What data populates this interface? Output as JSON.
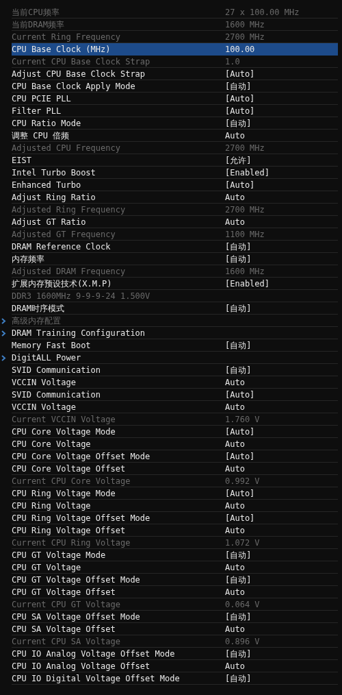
{
  "rows": [
    {
      "kind": "item",
      "label": "当前CPU频率",
      "value": "27 x 100.00 MHz",
      "disabled": true,
      "selected": false
    },
    {
      "kind": "item",
      "label": "当前DRAM频率",
      "value": "1600 MHz",
      "disabled": true,
      "selected": false
    },
    {
      "kind": "item",
      "label": "Current Ring Frequency",
      "value": "2700 MHz",
      "disabled": true,
      "selected": false
    },
    {
      "kind": "item",
      "label": "CPU Base Clock (MHz)",
      "value": "100.00",
      "disabled": false,
      "selected": true
    },
    {
      "kind": "item",
      "label": "Current CPU Base Clock Strap",
      "value": "1.0",
      "disabled": true,
      "selected": false
    },
    {
      "kind": "item",
      "label": "Adjust CPU Base Clock Strap",
      "value": "[Auto]",
      "disabled": false,
      "selected": false
    },
    {
      "kind": "item",
      "label": "CPU Base Clock Apply Mode",
      "value": "[自动]",
      "disabled": false,
      "selected": false
    },
    {
      "kind": "item",
      "label": "CPU PCIE PLL",
      "value": "[Auto]",
      "disabled": false,
      "selected": false
    },
    {
      "kind": "item",
      "label": "Filter PLL",
      "value": "[Auto]",
      "disabled": false,
      "selected": false
    },
    {
      "kind": "item",
      "label": "CPU Ratio Mode",
      "value": "[自动]",
      "disabled": false,
      "selected": false
    },
    {
      "kind": "item",
      "label": "调整 CPU 倍频",
      "value": "Auto",
      "disabled": false,
      "selected": false
    },
    {
      "kind": "item",
      "label": "Adjusted CPU Frequency",
      "value": "2700 MHz",
      "disabled": true,
      "selected": false
    },
    {
      "kind": "item",
      "label": "EIST",
      "value": "[允许]",
      "disabled": false,
      "selected": false
    },
    {
      "kind": "item",
      "label": "Intel Turbo Boost",
      "value": "[Enabled]",
      "disabled": false,
      "selected": false
    },
    {
      "kind": "item",
      "label": "Enhanced Turbo",
      "value": "[Auto]",
      "disabled": false,
      "selected": false
    },
    {
      "kind": "item",
      "label": "Adjust Ring Ratio",
      "value": "Auto",
      "disabled": false,
      "selected": false
    },
    {
      "kind": "item",
      "label": "Adjusted Ring Frequency",
      "value": "2700 MHz",
      "disabled": true,
      "selected": false
    },
    {
      "kind": "item",
      "label": "Adjust GT Ratio",
      "value": "Auto",
      "disabled": false,
      "selected": false
    },
    {
      "kind": "item",
      "label": "Adjusted GT Frequency",
      "value": "1100 MHz",
      "disabled": true,
      "selected": false
    },
    {
      "kind": "item",
      "label": "DRAM Reference Clock",
      "value": "[自动]",
      "disabled": false,
      "selected": false
    },
    {
      "kind": "item",
      "label": "内存频率",
      "value": "[自动]",
      "disabled": false,
      "selected": false
    },
    {
      "kind": "item",
      "label": "Adjusted DRAM Frequency",
      "value": "1600 MHz",
      "disabled": true,
      "selected": false
    },
    {
      "kind": "item",
      "label": "扩展内存预设技术(X.M.P)",
      "value": "[Enabled]",
      "disabled": false,
      "selected": false
    },
    {
      "kind": "item",
      "label": "DDR3 1600MHz 9-9-9-24 1.500V",
      "disabled": true,
      "selected": false
    },
    {
      "kind": "item",
      "label": "DRAM时序模式",
      "value": "[自动]",
      "disabled": false,
      "selected": false
    },
    {
      "kind": "submenu",
      "label": "高级内存配置",
      "disabled": true,
      "selected": false
    },
    {
      "kind": "submenu",
      "label": "DRAM Training Configuration",
      "disabled": false,
      "selected": false
    },
    {
      "kind": "item",
      "label": "Memory Fast Boot",
      "value": "[自动]",
      "disabled": false,
      "selected": false
    },
    {
      "kind": "submenu",
      "label": "DigitALL Power",
      "disabled": false,
      "selected": false
    },
    {
      "kind": "item",
      "label": "SVID Communication",
      "value": "[自动]",
      "disabled": false,
      "selected": false
    },
    {
      "kind": "item",
      "label": "VCCIN Voltage",
      "value": "Auto",
      "disabled": false,
      "selected": false
    },
    {
      "kind": "item",
      "label": "SVID Communication",
      "value": "[Auto]",
      "disabled": false,
      "selected": false
    },
    {
      "kind": "item",
      "label": "VCCIN Voltage",
      "value": "Auto",
      "disabled": false,
      "selected": false
    },
    {
      "kind": "item",
      "label": "Current VCCIN Voltage",
      "value": "1.760 V",
      "disabled": true,
      "selected": false
    },
    {
      "kind": "item",
      "label": "CPU Core Voltage Mode",
      "value": "[Auto]",
      "disabled": false,
      "selected": false
    },
    {
      "kind": "item",
      "label": "CPU Core Voltage",
      "value": "Auto",
      "disabled": false,
      "selected": false
    },
    {
      "kind": "item",
      "label": "CPU Core Voltage Offset Mode",
      "value": "[Auto]",
      "disabled": false,
      "selected": false
    },
    {
      "kind": "item",
      "label": "CPU Core Voltage Offset",
      "value": "Auto",
      "disabled": false,
      "selected": false
    },
    {
      "kind": "item",
      "label": "Current CPU Core Voltage",
      "value": "0.992 V",
      "disabled": true,
      "selected": false
    },
    {
      "kind": "item",
      "label": "CPU Ring Voltage Mode",
      "value": "[Auto]",
      "disabled": false,
      "selected": false
    },
    {
      "kind": "item",
      "label": "CPU Ring Voltage",
      "value": "Auto",
      "disabled": false,
      "selected": false
    },
    {
      "kind": "item",
      "label": "CPU Ring Voltage Offset Mode",
      "value": "[Auto]",
      "disabled": false,
      "selected": false
    },
    {
      "kind": "item",
      "label": "CPU Ring Voltage Offset",
      "value": "Auto",
      "disabled": false,
      "selected": false
    },
    {
      "kind": "item",
      "label": "Current CPU Ring Voltage",
      "value": "1.072 V",
      "disabled": true,
      "selected": false
    },
    {
      "kind": "item",
      "label": "CPU GT Voltage Mode",
      "value": "[自动]",
      "disabled": false,
      "selected": false
    },
    {
      "kind": "item",
      "label": "CPU GT Voltage",
      "value": "Auto",
      "disabled": false,
      "selected": false
    },
    {
      "kind": "item",
      "label": "CPU GT Voltage Offset Mode",
      "value": "[自动]",
      "disabled": false,
      "selected": false
    },
    {
      "kind": "item",
      "label": "CPU GT Voltage Offset",
      "value": "Auto",
      "disabled": false,
      "selected": false
    },
    {
      "kind": "item",
      "label": "Current CPU GT Voltage",
      "value": "0.064 V",
      "disabled": true,
      "selected": false
    },
    {
      "kind": "item",
      "label": "CPU SA Voltage Offset Mode",
      "value": "[自动]",
      "disabled": false,
      "selected": false
    },
    {
      "kind": "item",
      "label": "CPU SA Voltage Offset",
      "value": "Auto",
      "disabled": false,
      "selected": false
    },
    {
      "kind": "item",
      "label": "Current CPU SA Voltage",
      "value": "0.896 V",
      "disabled": true,
      "selected": false
    },
    {
      "kind": "item",
      "label": "CPU IO Analog Voltage Offset Mode",
      "value": "[自动]",
      "disabled": false,
      "selected": false
    },
    {
      "kind": "item",
      "label": "CPU IO Analog Voltage Offset",
      "value": "Auto",
      "disabled": false,
      "selected": false
    },
    {
      "kind": "item",
      "label": "CPU IO Digital Voltage Offset Mode",
      "value": "[自动]",
      "disabled": false,
      "selected": false
    }
  ]
}
